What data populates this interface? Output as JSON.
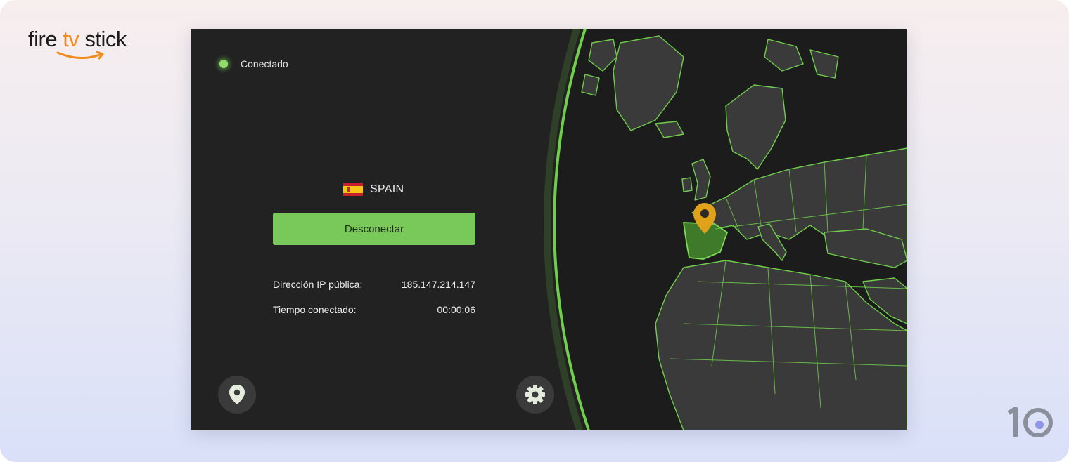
{
  "brand": {
    "logo_text": "fire tv stick"
  },
  "watermark": {
    "logo_text": "10"
  },
  "status": {
    "label": "Conectado",
    "color": "#8fe06a"
  },
  "location": {
    "country": "SPAIN",
    "flag": "spain-flag-icon"
  },
  "actions": {
    "disconnect_label": "Desconectar"
  },
  "info": {
    "ip_label": "Dirección IP pública:",
    "ip_value": "185.147.214.147",
    "time_label": "Tiempo conectado:",
    "time_value": "00:00:06"
  },
  "nav": {
    "location_icon": "location-pin-icon",
    "settings_icon": "gear-icon"
  },
  "map": {
    "highlighted_country": "Spain",
    "marker_icon": "map-pin-icon",
    "accent": "#6fcf4a",
    "marker_color": "#e0a21a"
  },
  "colors": {
    "accent": "#79c95a",
    "background": "#222222"
  }
}
